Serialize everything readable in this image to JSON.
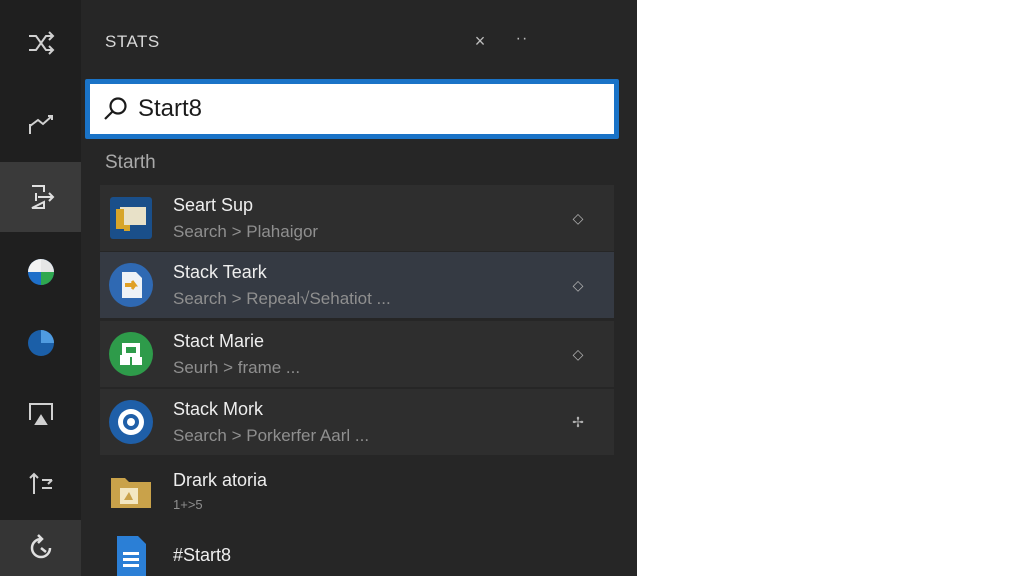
{
  "panel": {
    "title": "STATS",
    "close_glyph": "×",
    "more_glyph": "··"
  },
  "search": {
    "value": "Start8",
    "placeholder": ""
  },
  "section": {
    "label": "Starth"
  },
  "results": [
    {
      "title": "Seart Sup",
      "subtitle": "Search > Plahaigor",
      "icon": "document-folder-icon",
      "action": "pin-icon"
    },
    {
      "title": "Stack Teark",
      "subtitle": "Search > Repeal√Sehatiot ...",
      "icon": "arrow-file-icon",
      "action": "pin-icon"
    },
    {
      "title": "Stact Marie",
      "subtitle": "Seurh > frame ...",
      "icon": "green-app-icon",
      "action": "pin-icon"
    },
    {
      "title": "Stack Mork",
      "subtitle": "Search > Porkerfer Aarl ...",
      "icon": "blue-ring-icon",
      "action": "pin-icon"
    },
    {
      "title": "Drark atoria",
      "subtitle": "1+>5",
      "icon": "folder-icon",
      "action": ""
    },
    {
      "title": "#Start8",
      "subtitle": "",
      "icon": "document-icon",
      "action": ""
    }
  ],
  "rail": {
    "items": [
      {
        "icon": "shuffle-icon"
      },
      {
        "icon": "chart-line-icon"
      },
      {
        "icon": "export-icon"
      },
      {
        "icon": "globe-pie-icon"
      },
      {
        "icon": "pie-chart-icon"
      },
      {
        "icon": "screen-share-icon"
      },
      {
        "icon": "sort-arrows-icon"
      },
      {
        "icon": "refresh-icon"
      }
    ]
  },
  "colors": {
    "accent": "#1a73c7",
    "panel_bg": "#262626",
    "rail_bg": "#1f1f1f",
    "highlight_row": "#353a43"
  }
}
